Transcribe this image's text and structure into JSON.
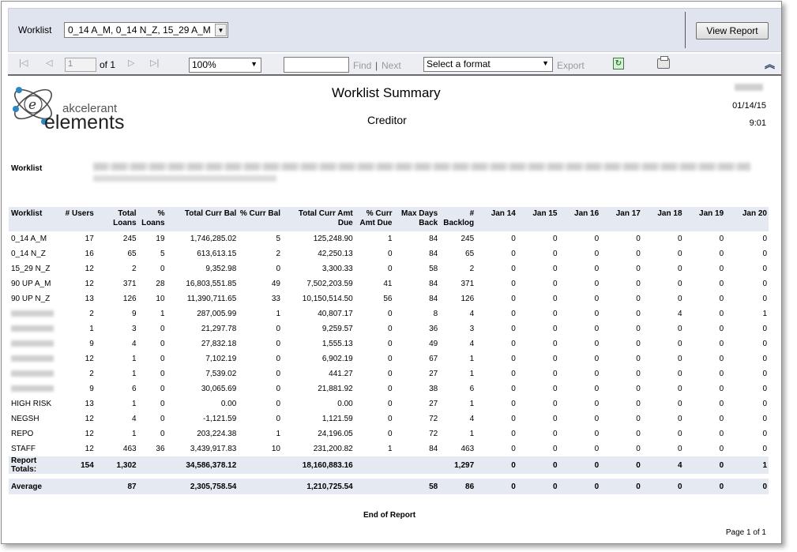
{
  "params": {
    "worklist_label": "Worklist",
    "worklist_value": "0_14 A_M, 0_14 N_Z, 15_29 A_M",
    "view_report_label": "View Report"
  },
  "toolbar": {
    "page_value": "1",
    "page_of": "of 1",
    "zoom_value": "100%",
    "find_label": "Find",
    "find_separator": "|",
    "next_label": "Next",
    "format_placeholder": "Select a format",
    "export_label": "Export",
    "first_page_icon": "first-page-icon",
    "prev_page_icon": "prev-page-icon",
    "next_page_icon": "next-page-icon",
    "last_page_icon": "last-page-icon",
    "refresh_icon": "refresh-icon",
    "print_icon": "print-icon",
    "collapse_icon": "collapse-icon"
  },
  "report": {
    "logo_top": "akcelerant",
    "logo_bottom": "elements",
    "title": "Worklist Summary",
    "subtitle": "Creditor",
    "date": "01/14/15",
    "time": "9:01",
    "worklist_label": "Worklist",
    "end_label": "End of Report",
    "page_footer": "Page 1 of 1"
  },
  "table": {
    "headers": {
      "worklist": "Worklist",
      "users": "# Users",
      "total_loans_1": "Total",
      "total_loans_2": "Loans",
      "pct_loans_1": "%",
      "pct_loans_2": "Loans",
      "total_curr_bal": "Total Curr Bal",
      "pct_curr_bal": "% Curr Bal",
      "total_curr_amt_1": "Total Curr Amt",
      "total_curr_amt_2": "Due",
      "pct_curr_amt_1": "% Curr",
      "pct_curr_amt_2": "Amt Due",
      "max_days_1": "Max Days",
      "max_days_2": "Back",
      "backlog_1": "#",
      "backlog_2": "Backlog",
      "jan14": "Jan 14",
      "jan15": "Jan 15",
      "jan16": "Jan 16",
      "jan17": "Jan 17",
      "jan18": "Jan 18",
      "jan19": "Jan 19",
      "jan20": "Jan 20"
    },
    "rows": [
      [
        "0_14 A_M",
        "17",
        "245",
        "19",
        "1,746,285.02",
        "5",
        "125,248.90",
        "1",
        "84",
        "245",
        "0",
        "0",
        "0",
        "0",
        "0",
        "0",
        "0"
      ],
      [
        "0_14 N_Z",
        "16",
        "65",
        "5",
        "613,613.15",
        "2",
        "42,250.13",
        "0",
        "84",
        "65",
        "0",
        "0",
        "0",
        "0",
        "0",
        "0",
        "0"
      ],
      [
        "15_29 N_Z",
        "12",
        "2",
        "0",
        "9,352.98",
        "0",
        "3,300.33",
        "0",
        "58",
        "2",
        "0",
        "0",
        "0",
        "0",
        "0",
        "0",
        "0"
      ],
      [
        "90 UP A_M",
        "12",
        "371",
        "28",
        "16,803,551.85",
        "49",
        "7,502,203.59",
        "41",
        "84",
        "371",
        "0",
        "0",
        "0",
        "0",
        "0",
        "0",
        "0"
      ],
      [
        "90 UP N_Z",
        "13",
        "126",
        "10",
        "11,390,711.65",
        "33",
        "10,150,514.50",
        "56",
        "84",
        "126",
        "0",
        "0",
        "0",
        "0",
        "0",
        "0",
        "0"
      ],
      [
        "",
        "2",
        "9",
        "1",
        "287,005.99",
        "1",
        "40,807.17",
        "0",
        "8",
        "4",
        "0",
        "0",
        "0",
        "0",
        "4",
        "0",
        "1"
      ],
      [
        "",
        "1",
        "3",
        "0",
        "21,297.78",
        "0",
        "9,259.57",
        "0",
        "36",
        "3",
        "0",
        "0",
        "0",
        "0",
        "0",
        "0",
        "0"
      ],
      [
        "",
        "9",
        "4",
        "0",
        "27,832.18",
        "0",
        "1,555.13",
        "0",
        "49",
        "4",
        "0",
        "0",
        "0",
        "0",
        "0",
        "0",
        "0"
      ],
      [
        "",
        "12",
        "1",
        "0",
        "7,102.19",
        "0",
        "6,902.19",
        "0",
        "67",
        "1",
        "0",
        "0",
        "0",
        "0",
        "0",
        "0",
        "0"
      ],
      [
        "",
        "2",
        "1",
        "0",
        "7,539.02",
        "0",
        "441.27",
        "0",
        "27",
        "1",
        "0",
        "0",
        "0",
        "0",
        "0",
        "0",
        "0"
      ],
      [
        "",
        "9",
        "6",
        "0",
        "30,065.69",
        "0",
        "21,881.92",
        "0",
        "38",
        "6",
        "0",
        "0",
        "0",
        "0",
        "0",
        "0",
        "0"
      ],
      [
        "HIGH RISK",
        "13",
        "1",
        "0",
        "0.00",
        "0",
        "0.00",
        "0",
        "27",
        "1",
        "0",
        "0",
        "0",
        "0",
        "0",
        "0",
        "0"
      ],
      [
        "NEGSH",
        "12",
        "4",
        "0",
        "-1,121.59",
        "0",
        "1,121.59",
        "0",
        "72",
        "4",
        "0",
        "0",
        "0",
        "0",
        "0",
        "0",
        "0"
      ],
      [
        "REPO",
        "12",
        "1",
        "0",
        "203,224.38",
        "1",
        "24,196.05",
        "0",
        "72",
        "1",
        "0",
        "0",
        "0",
        "0",
        "0",
        "0",
        "0"
      ],
      [
        "STAFF",
        "12",
        "463",
        "36",
        "3,439,917.83",
        "10",
        "231,200.82",
        "1",
        "84",
        "463",
        "0",
        "0",
        "0",
        "0",
        "0",
        "0",
        "0"
      ]
    ],
    "totals": [
      "Report Totals:",
      "154",
      "1,302",
      "",
      "34,586,378.12",
      "",
      "18,160,883.16",
      "",
      "",
      "1,297",
      "0",
      "0",
      "0",
      "0",
      "4",
      "0",
      "1"
    ],
    "average": [
      "Average",
      "",
      "87",
      "",
      "2,305,758.54",
      "",
      "1,210,725.54",
      "",
      "58",
      "86",
      "0",
      "0",
      "0",
      "0",
      "0",
      "0",
      "0"
    ]
  }
}
